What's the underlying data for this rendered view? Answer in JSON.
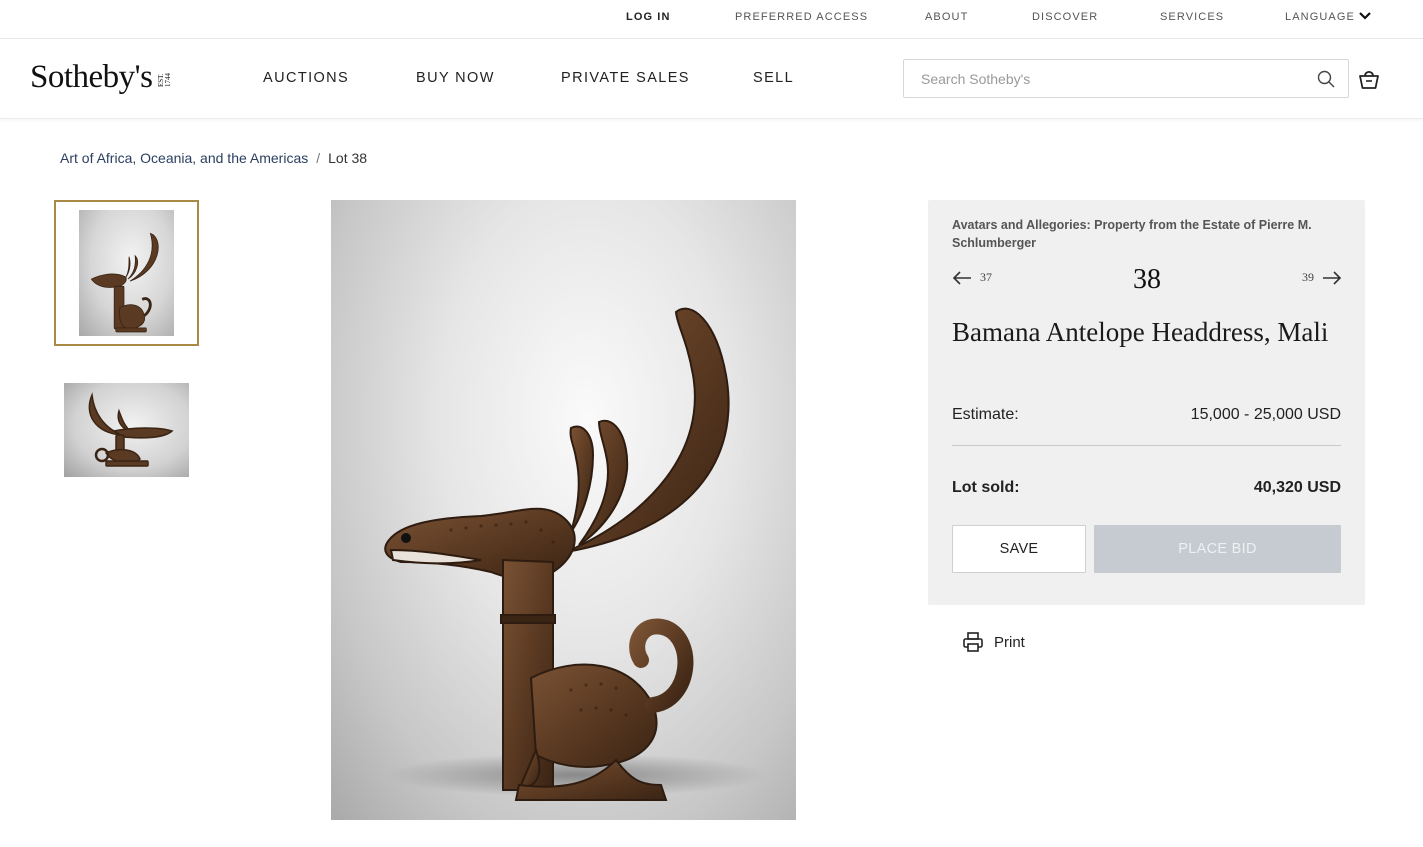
{
  "utility_nav": {
    "login": "LOG IN",
    "preferred_access": "PREFERRED ACCESS",
    "about": "ABOUT",
    "discover": "DISCOVER",
    "services": "SERVICES",
    "language": "LANGUAGE"
  },
  "brand": {
    "name": "Sotheby's",
    "est": "EST. 1744"
  },
  "main_nav": {
    "auctions": "AUCTIONS",
    "buy_now": "BUY NOW",
    "private_sales": "PRIVATE SALES",
    "sell": "SELL"
  },
  "search": {
    "placeholder": "Search Sotheby's",
    "value": ""
  },
  "breadcrumb": {
    "department": "Art of Africa, Oceania, and the Americas",
    "separator": "/",
    "current": "Lot 38"
  },
  "lot": {
    "sale_title": "Avatars and Allegories: Property from the Estate of Pierre M. Schlumberger",
    "prev_lot": "37",
    "lot_number": "38",
    "next_lot": "39",
    "title": "Bamana Antelope Headdress, Mali",
    "estimate_label": "Estimate:",
    "estimate_value": "15,000 - 25,000 USD",
    "sold_label": "Lot sold:",
    "sold_value": "40,320 USD",
    "save_label": "SAVE",
    "bid_label": "PLACE BID"
  },
  "print_label": "Print",
  "colors": {
    "accent_border": "#a88a45",
    "disabled_button": "#c5cbd1",
    "panel_bg": "#f0f0f0"
  }
}
